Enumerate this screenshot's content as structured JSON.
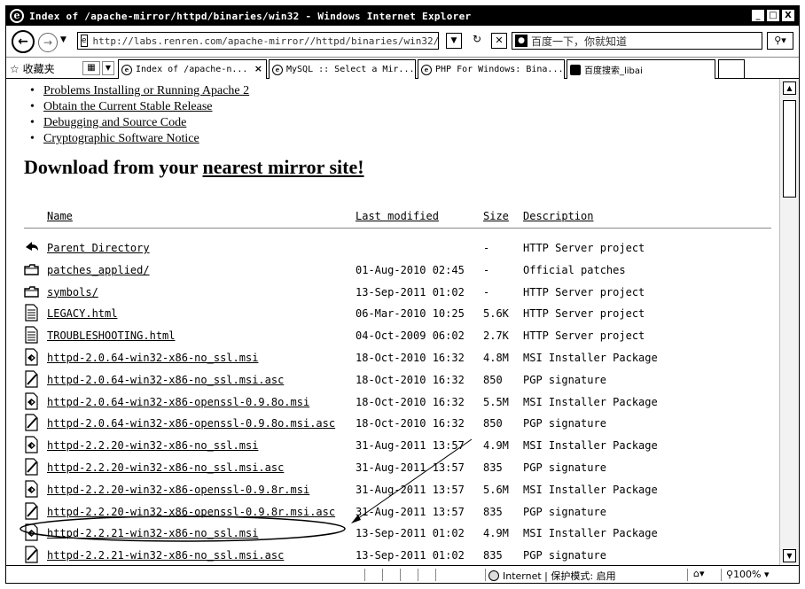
{
  "window": {
    "title": "Index of /apache-mirror/httpd/binaries/win32 - Windows Internet Explorer",
    "minimize": "_",
    "maximize": "□",
    "close": "X"
  },
  "address_bar": {
    "url": "http://labs.renren.com/apache-mirror//httpd/binaries/win32/",
    "search_text": "百度一下，你就知道"
  },
  "favorites_label": "收藏夹",
  "tabs": [
    {
      "label": "Index of /apache-n...",
      "active": true,
      "close": "×"
    },
    {
      "label": "MySQL :: Select a Mir...",
      "active": false
    },
    {
      "label": "PHP For Windows: Bina...",
      "active": false
    },
    {
      "label": "百度搜索_libai",
      "active": false
    }
  ],
  "page": {
    "links": [
      "Problems Installing or Running Apache 2",
      "Obtain the Current Stable Release",
      "Debugging and Source Code",
      "Cryptographic Software Notice"
    ],
    "heading_prefix": "Download from your ",
    "heading_link": "nearest mirror site!",
    "columns": {
      "name": "Name",
      "modified": "Last modified",
      "size": "Size",
      "description": "Description"
    },
    "rows": [
      {
        "icon": "back",
        "name": "Parent Directory",
        "date": "",
        "size": "-",
        "desc": "HTTP Server project"
      },
      {
        "icon": "folder",
        "name": "patches_applied/",
        "date": "01-Aug-2010 02:45",
        "size": "-",
        "desc": "Official patches"
      },
      {
        "icon": "folder",
        "name": "symbols/",
        "date": "13-Sep-2011 01:02",
        "size": "-",
        "desc": "HTTP Server project"
      },
      {
        "icon": "text",
        "name": "LEGACY.html",
        "date": "06-Mar-2010 10:25",
        "size": "5.6K",
        "desc": "HTTP Server project"
      },
      {
        "icon": "text",
        "name": "TROUBLESHOOTING.html",
        "date": "04-Oct-2009 06:02",
        "size": "2.7K",
        "desc": "HTTP Server project"
      },
      {
        "icon": "package",
        "name": "httpd-2.0.64-win32-x86-no_ssl.msi",
        "date": "18-Oct-2010 16:32",
        "size": "4.8M",
        "desc": "MSI Installer Package"
      },
      {
        "icon": "signature",
        "name": "httpd-2.0.64-win32-x86-no_ssl.msi.asc",
        "date": "18-Oct-2010 16:32",
        "size": "850",
        "desc": "PGP signature"
      },
      {
        "icon": "package",
        "name": "httpd-2.0.64-win32-x86-openssl-0.9.8o.msi",
        "date": "18-Oct-2010 16:32",
        "size": "5.5M",
        "desc": "MSI Installer Package"
      },
      {
        "icon": "signature",
        "name": "httpd-2.0.64-win32-x86-openssl-0.9.8o.msi.asc",
        "date": "18-Oct-2010 16:32",
        "size": "850",
        "desc": "PGP signature"
      },
      {
        "icon": "package",
        "name": "httpd-2.2.20-win32-x86-no_ssl.msi",
        "date": "31-Aug-2011 13:57",
        "size": "4.9M",
        "desc": "MSI Installer Package"
      },
      {
        "icon": "signature",
        "name": "httpd-2.2.20-win32-x86-no_ssl.msi.asc",
        "date": "31-Aug-2011 13:57",
        "size": "835",
        "desc": "PGP signature"
      },
      {
        "icon": "package",
        "name": "httpd-2.2.20-win32-x86-openssl-0.9.8r.msi",
        "date": "31-Aug-2011 13:57",
        "size": "5.6M",
        "desc": "MSI Installer Package"
      },
      {
        "icon": "signature",
        "name": "httpd-2.2.20-win32-x86-openssl-0.9.8r.msi.asc",
        "date": "31-Aug-2011 13:57",
        "size": "835",
        "desc": "PGP signature"
      },
      {
        "icon": "package",
        "name": "httpd-2.2.21-win32-x86-no_ssl.msi",
        "date": "13-Sep-2011 01:02",
        "size": "4.9M",
        "desc": "MSI Installer Package",
        "highlighted": true
      },
      {
        "icon": "signature",
        "name": "httpd-2.2.21-win32-x86-no_ssl.msi.asc",
        "date": "13-Sep-2011 01:02",
        "size": "835",
        "desc": "PGP signature"
      }
    ]
  },
  "status_bar": {
    "zone": "Internet | 保护模式: 启用",
    "zoom": "100%"
  }
}
